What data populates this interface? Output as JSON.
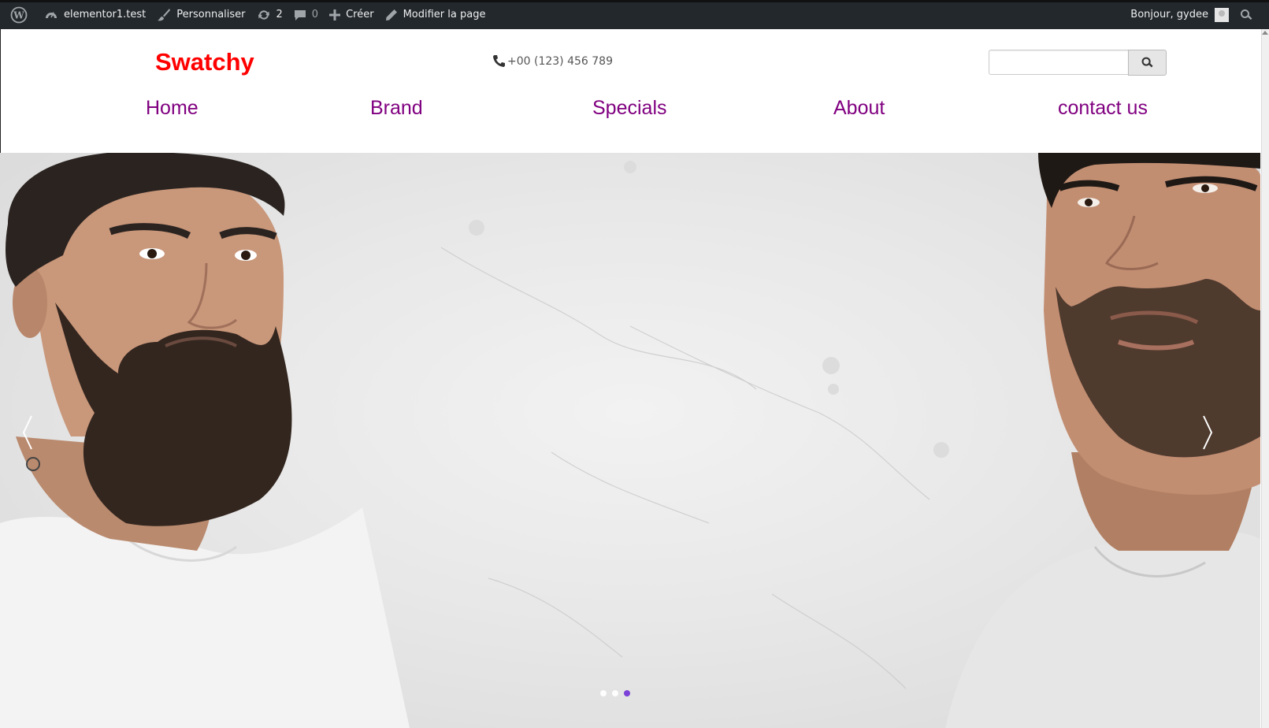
{
  "adminbar": {
    "site_name": "elementor1.test",
    "customize": "Personnaliser",
    "updates_count": "2",
    "comments_count": "0",
    "new": "Créer",
    "edit_page": "Modifier la page",
    "greeting": "Bonjour, gydee"
  },
  "header": {
    "brand": "Swatchy",
    "phone": "+00 (123) 456 789",
    "search": {
      "value": "",
      "placeholder": ""
    }
  },
  "nav": {
    "items": [
      {
        "label": "Home"
      },
      {
        "label": "Brand"
      },
      {
        "label": "Specials"
      },
      {
        "label": "About"
      },
      {
        "label": "contact us"
      }
    ]
  },
  "slider": {
    "slide_count": 3,
    "active_slide": 3
  },
  "colors": {
    "brand": "#ff0000",
    "nav_link": "#800080",
    "adminbar_bg": "#23282d",
    "active_dot": "#6f2fd6"
  }
}
